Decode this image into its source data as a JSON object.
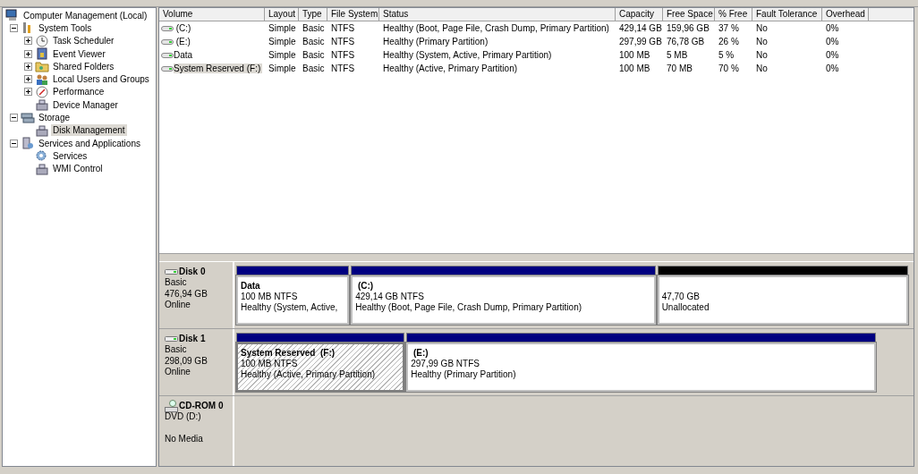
{
  "tree": {
    "items": [
      {
        "label": "Computer Management (Local)",
        "kind": "computer",
        "selected": false,
        "children": [
          {
            "label": "System Tools",
            "kind": "tools",
            "selected": false,
            "expanded": true,
            "children": [
              {
                "label": "Task Scheduler",
                "kind": "clock",
                "selected": false,
                "expanded": false
              },
              {
                "label": "Event Viewer",
                "kind": "log",
                "selected": false,
                "expanded": false
              },
              {
                "label": "Shared Folders",
                "kind": "folder",
                "selected": false,
                "expanded": false
              },
              {
                "label": "Local Users and Groups",
                "kind": "users",
                "selected": false,
                "expanded": false
              },
              {
                "label": "Performance",
                "kind": "gauge",
                "selected": false,
                "expanded": false
              },
              {
                "label": "Device Manager",
                "kind": "device",
                "selected": false
              }
            ]
          },
          {
            "label": "Storage",
            "kind": "storage",
            "selected": false,
            "expanded": true,
            "children": [
              {
                "label": "Disk Management",
                "kind": "device",
                "selected": true
              }
            ]
          },
          {
            "label": "Services and Applications",
            "kind": "server",
            "selected": false,
            "expanded": true,
            "children": [
              {
                "label": "Services",
                "kind": "gear",
                "selected": false
              },
              {
                "label": "WMI Control",
                "kind": "device",
                "selected": false
              }
            ]
          }
        ]
      }
    ]
  },
  "volumes": {
    "columns": [
      "Volume",
      "Layout",
      "Type",
      "File System",
      "Status",
      "Capacity",
      "Free Space",
      "% Free",
      "Fault Tolerance",
      "Overhead"
    ],
    "rows": [
      {
        "selected": false,
        "cells": [
          " (C:)",
          "Simple",
          "Basic",
          "NTFS",
          "Healthy (Boot, Page File, Crash Dump, Primary Partition)",
          "429,14 GB",
          "159,96 GB",
          "37 %",
          "No",
          "0%"
        ]
      },
      {
        "selected": false,
        "cells": [
          " (E:)",
          "Simple",
          "Basic",
          "NTFS",
          "Healthy (Primary Partition)",
          "297,99 GB",
          "76,78 GB",
          "26 %",
          "No",
          "0%"
        ]
      },
      {
        "selected": false,
        "cells": [
          "Data",
          "Simple",
          "Basic",
          "NTFS",
          "Healthy (System, Active, Primary Partition)",
          "100 MB",
          "5 MB",
          "5 %",
          "No",
          "0%"
        ]
      },
      {
        "selected": true,
        "cells": [
          "System Reserved (F:)",
          "Simple",
          "Basic",
          "NTFS",
          "Healthy (Active, Primary Partition)",
          "100 MB",
          "70 MB",
          "70 %",
          "No",
          "0%"
        ]
      }
    ]
  },
  "disks": [
    {
      "kind": "disk",
      "name": "Disk 0",
      "type": "Basic",
      "size": "476,94 GB",
      "status": "Online",
      "partitions": [
        {
          "kind": "primary",
          "selected": false,
          "name": "Data",
          "size": "100 MB NTFS",
          "status": "Healthy (System, Active,"
        },
        {
          "kind": "primary",
          "selected": false,
          "name": " (C:)",
          "size": "429,14 GB NTFS",
          "status": "Healthy (Boot, Page File, Crash Dump, Primary Partition)"
        },
        {
          "kind": "unallocated",
          "selected": false,
          "size": "47,70 GB",
          "status": "Unallocated"
        }
      ]
    },
    {
      "kind": "disk",
      "name": "Disk 1",
      "type": "Basic",
      "size": "298,09 GB",
      "status": "Online",
      "partitions": [
        {
          "kind": "primary",
          "selected": true,
          "name": "System Reserved  (F:)",
          "size": "100 MB NTFS",
          "status": "Healthy (Active, Primary Partition)"
        },
        {
          "kind": "primary",
          "selected": false,
          "name": " (E:)",
          "size": "297,99 GB NTFS",
          "status": "Healthy (Primary Partition)"
        }
      ]
    },
    {
      "kind": "cdrom",
      "name": "CD-ROM 0",
      "type": "DVD (D:)",
      "status": "No Media"
    }
  ]
}
